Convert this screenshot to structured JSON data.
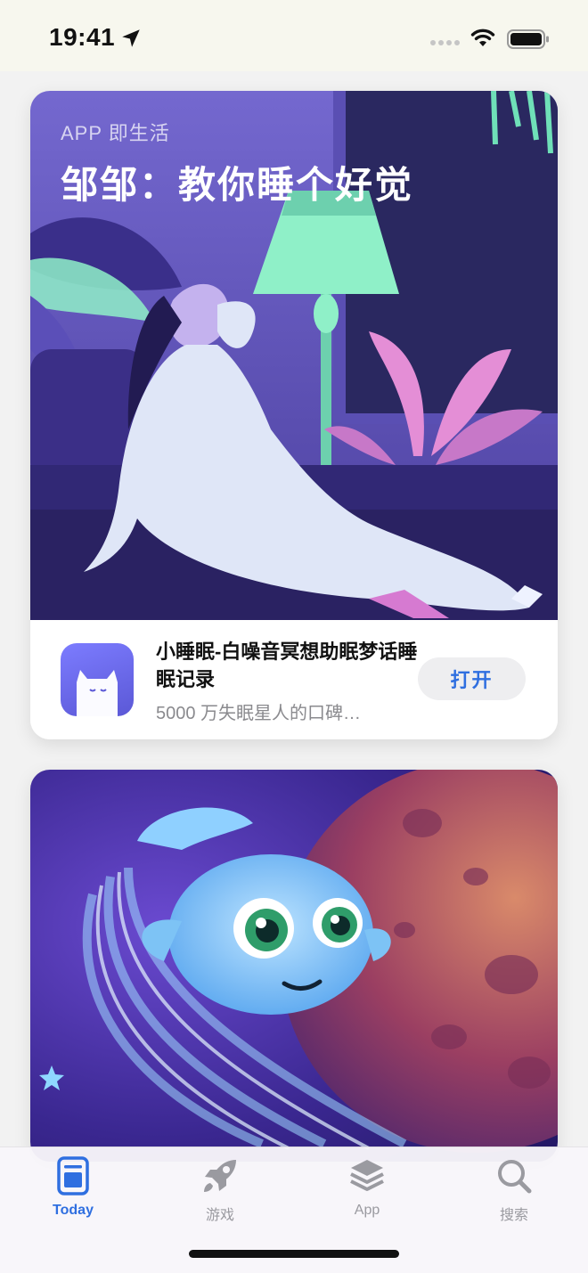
{
  "status_bar": {
    "time": "19:41",
    "icons": [
      "location-arrow-icon",
      "signal-dots-icon",
      "wifi-icon",
      "battery-icon"
    ]
  },
  "cards": [
    {
      "eyebrow": "APP 即生活",
      "title": "邹邹：教你睡个好觉",
      "app": {
        "name": "小睡眠-白噪音冥想助眠梦话睡眠记录",
        "subtitle": "5000 万失眠星人的口碑…",
        "action_label": "打开",
        "icon": "sleeping-cat-icon"
      },
      "art": "woman-relaxing-under-lamp-illustration"
    },
    {
      "art": "glowing-fish-and-planet-illustration"
    }
  ],
  "tab_bar": {
    "tabs": [
      {
        "label": "Today",
        "icon": "today-icon",
        "active": true
      },
      {
        "label": "游戏",
        "icon": "rocket-icon",
        "active": false
      },
      {
        "label": "App",
        "icon": "layers-icon",
        "active": false
      },
      {
        "label": "搜索",
        "icon": "search-icon",
        "active": false
      }
    ]
  },
  "colors": {
    "accent": "#2f6fe0",
    "card1_bg": "#6f62c9",
    "card2_bg": "#3c2a8a"
  }
}
